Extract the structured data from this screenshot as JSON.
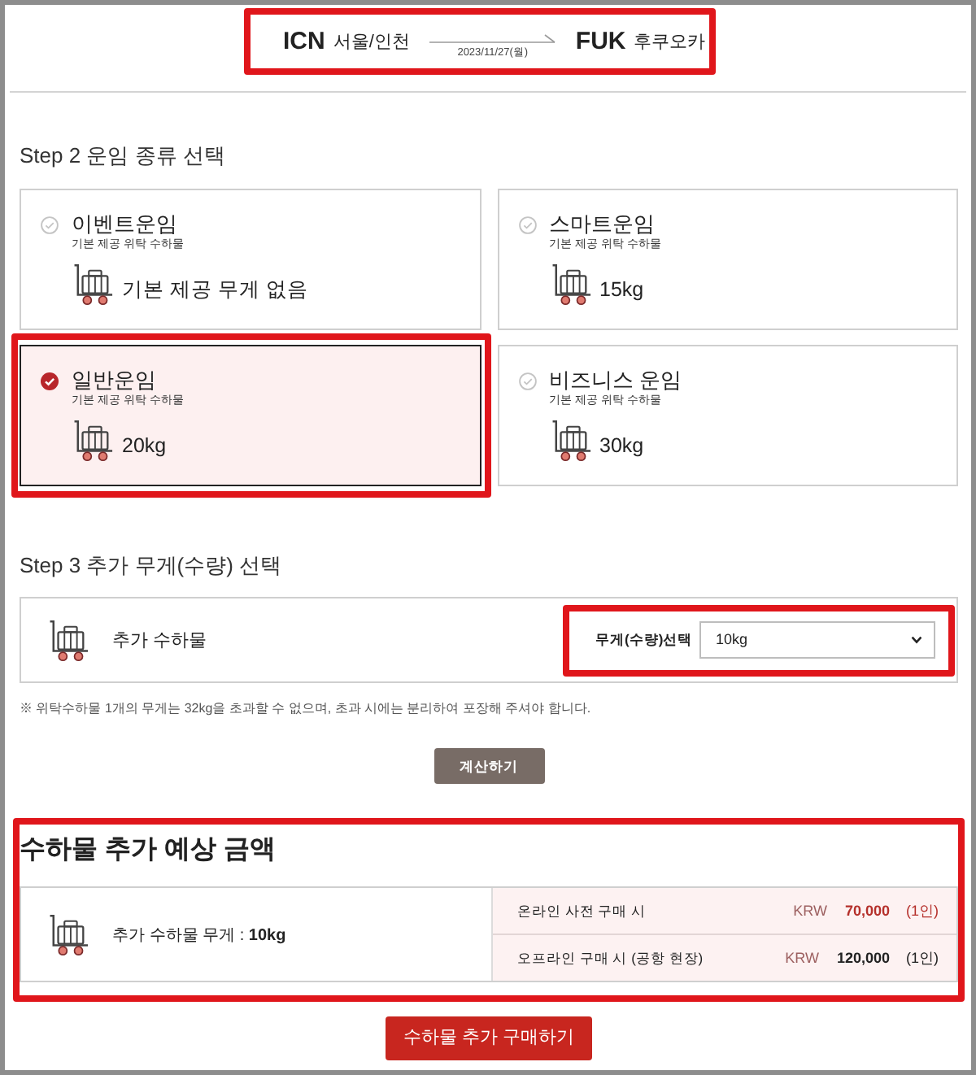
{
  "route": {
    "highlighted": true,
    "origin": {
      "code": "ICN",
      "city": "서울/인천"
    },
    "date": "2023/11/27(월)",
    "destination": {
      "code": "FUK",
      "city": "후쿠오카"
    }
  },
  "step2": {
    "heading": "Step 2 운임 종류 선택",
    "fares": [
      {
        "name": "이벤트운임",
        "subtitle": "기본 제공 위탁 수하물",
        "allowance": "기본 제공 무게 없음",
        "selected": false,
        "highlighted": false
      },
      {
        "name": "스마트운임",
        "subtitle": "기본 제공 위탁 수하물",
        "allowance": "15kg",
        "selected": false,
        "highlighted": false
      },
      {
        "name": "일반운임",
        "subtitle": "기본 제공 위탁 수하물",
        "allowance": "20kg",
        "selected": true,
        "highlighted": true
      },
      {
        "name": "비즈니스 운임",
        "subtitle": "기본 제공 위탁 수하물",
        "allowance": "30kg",
        "selected": false,
        "highlighted": false
      }
    ]
  },
  "step3": {
    "heading": "Step 3 추가 무게(수량) 선택",
    "item_label": "추가 수하물",
    "weight_select": {
      "label": "무게(수량)선택",
      "value": "10kg",
      "highlighted": true
    },
    "note": "※ 위탁수하물 1개의 무게는 32kg을 초과할 수 없으며, 초과 시에는 분리하여 포장해 주셔야 합니다.",
    "calculate_button": "계산하기"
  },
  "estimate": {
    "highlighted": true,
    "title": "수하물 추가 예상 금액",
    "weight": "추가 수하물 무게 : **10kg**",
    "prices": [
      {
        "label": "온라인 사전 구매 시",
        "currency": "KRW",
        "amount": "70,000",
        "per_person": "(1인)",
        "emphasized": true
      },
      {
        "label": "오프라인 구매 시 (공항 현장)",
        "currency": "KRW",
        "amount": "120,000",
        "per_person": "(1인)",
        "emphasized": false
      }
    ]
  },
  "purchase_button": "수하물 추가 구매하기"
}
